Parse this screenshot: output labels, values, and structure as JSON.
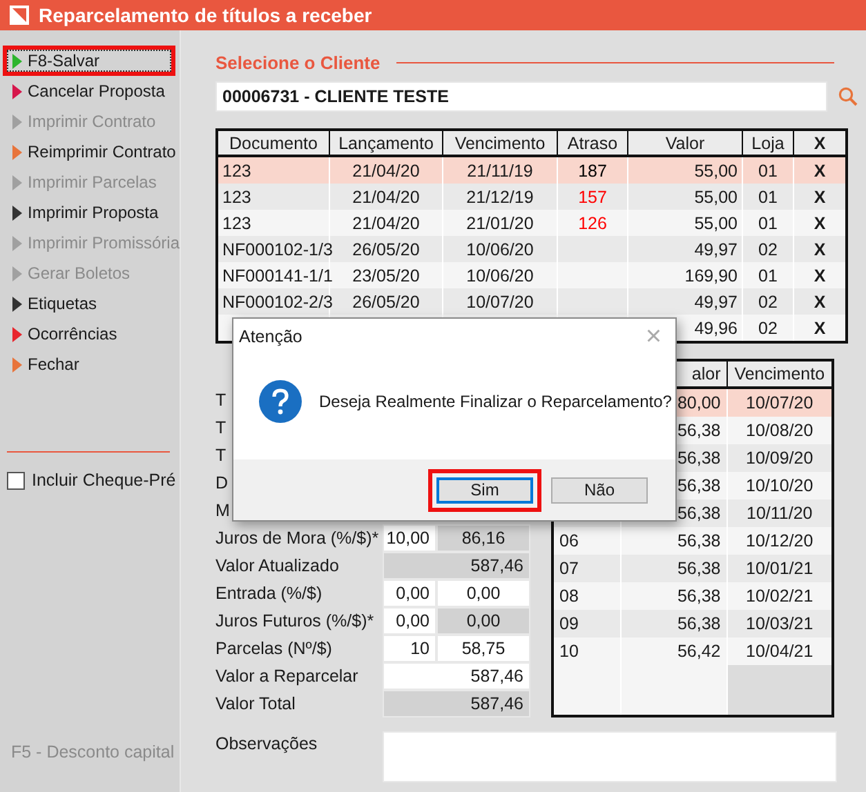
{
  "window": {
    "title": "Reparcelamento de títulos a receber"
  },
  "sidebar": {
    "items": [
      {
        "label": "F8-Salvar",
        "color": "#2db52d",
        "disabled": false,
        "focused": true,
        "highlighted": true
      },
      {
        "label": "Cancelar Proposta",
        "color": "#d6164b",
        "disabled": false,
        "focused": false,
        "highlighted": false
      },
      {
        "label": "Imprimir Contrato",
        "color": "#a0a0a0",
        "disabled": true,
        "focused": false,
        "highlighted": false
      },
      {
        "label": "Reimprimir Contrato",
        "color": "#e8743b",
        "disabled": false,
        "focused": false,
        "highlighted": false
      },
      {
        "label": "Imprimir Parcelas",
        "color": "#a0a0a0",
        "disabled": true,
        "focused": false,
        "highlighted": false
      },
      {
        "label": "Imprimir Proposta",
        "color": "#333333",
        "disabled": false,
        "focused": false,
        "highlighted": false
      },
      {
        "label": "Imprimir Promissória",
        "color": "#a0a0a0",
        "disabled": true,
        "focused": false,
        "highlighted": false
      },
      {
        "label": "Gerar Boletos",
        "color": "#a0a0a0",
        "disabled": true,
        "focused": false,
        "highlighted": false
      },
      {
        "label": "Etiquetas",
        "color": "#333333",
        "disabled": false,
        "focused": false,
        "highlighted": false
      },
      {
        "label": "Ocorrências",
        "color": "#e8242c",
        "disabled": false,
        "focused": false,
        "highlighted": false
      },
      {
        "label": "Fechar",
        "color": "#e8743b",
        "disabled": false,
        "focused": false,
        "highlighted": false
      }
    ],
    "checkbox": {
      "label": "Incluir Cheque-Pré",
      "checked": false
    },
    "footer": "F5 - Desconto capital"
  },
  "client": {
    "heading": "Selecione o Cliente",
    "value": "00006731 - CLIENTE TESTE"
  },
  "titles_table": {
    "columns": [
      "Documento",
      "Lançamento",
      "Vencimento",
      "Atraso",
      "Valor",
      "Loja",
      "X"
    ],
    "rows": [
      {
        "documento": "123",
        "lancamento": "21/04/20",
        "vencimento": "21/11/19",
        "atraso": "187",
        "color": "#000000",
        "valor": "55,00",
        "loja": "01",
        "remove": "X",
        "selected": true
      },
      {
        "documento": "123",
        "lancamento": "21/04/20",
        "vencimento": "21/12/19",
        "atraso": "157",
        "color": "#ff0000",
        "valor": "55,00",
        "loja": "01",
        "remove": "X",
        "selected": false
      },
      {
        "documento": "123",
        "lancamento": "21/04/20",
        "vencimento": "21/01/20",
        "atraso": "126",
        "color": "#ff0000",
        "valor": "55,00",
        "loja": "01",
        "remove": "X",
        "selected": false
      },
      {
        "documento": "NF000102-1/3",
        "lancamento": "26/05/20",
        "vencimento": "10/06/20",
        "valor": "49,97",
        "loja": "02",
        "remove": "X",
        "selected": false
      },
      {
        "documento": "NF000141-1/1",
        "lancamento": "23/05/20",
        "vencimento": "10/06/20",
        "valor": "169,90",
        "loja": "01",
        "remove": "X",
        "selected": false
      },
      {
        "documento": "NF000102-2/3",
        "lancamento": "26/05/20",
        "vencimento": "10/07/20",
        "valor": "49,97",
        "loja": "02",
        "remove": "X",
        "selected": false
      },
      {
        "valor": "49,96",
        "loja": "02",
        "remove": "X",
        "selected": false
      }
    ]
  },
  "form": {
    "rows": [
      {
        "label": "T"
      },
      {
        "label": "T"
      },
      {
        "label": "T"
      },
      {
        "label": "D"
      },
      {
        "label": "M"
      },
      {
        "label": "Juros de Mora (%/$)*",
        "cells": [
          {
            "text": "10,00",
            "editable": true
          },
          {
            "text": "86,16",
            "editable": false
          }
        ]
      },
      {
        "label": "Valor Atualizado",
        "cells": [
          {
            "text": "587,46",
            "editable": false
          }
        ]
      },
      {
        "label": "Entrada (%/$)",
        "cells": [
          {
            "text": "0,00",
            "editable": true
          },
          {
            "text": "0,00",
            "editable": true
          }
        ]
      },
      {
        "label": "Juros Futuros (%/$)*",
        "cells": [
          {
            "text": "0,00",
            "editable": true
          },
          {
            "text": "0,00",
            "editable": false
          }
        ]
      },
      {
        "label": "Parcelas (Nº/$)",
        "cells": [
          {
            "text": "10",
            "editable": true
          },
          {
            "text": "58,75",
            "editable": true
          }
        ]
      },
      {
        "label": "Valor a Reparcelar",
        "cells": [
          {
            "text": "587,46",
            "editable": true
          }
        ]
      },
      {
        "label": "Valor Total",
        "cells": [
          {
            "text": "587,46",
            "editable": false
          }
        ]
      }
    ],
    "notes_label": "Observações"
  },
  "installments_table": {
    "columns": [
      "alor",
      "Vencimento"
    ],
    "rows": [
      {
        "valor": "80,00",
        "vencimento": "10/07/20",
        "selected": true
      },
      {
        "valor": "56,38",
        "vencimento": "10/08/20",
        "selected": false
      },
      {
        "valor": "56,38",
        "vencimento": "10/09/20",
        "selected": false
      },
      {
        "valor": "56,38",
        "vencimento": "10/10/20",
        "selected": false
      },
      {
        "valor": "56,38",
        "vencimento": "10/11/20",
        "selected": false
      },
      {
        "parcela": "06",
        "valor": "56,38",
        "vencimento": "10/12/20",
        "selected": false
      },
      {
        "parcela": "07",
        "valor": "56,38",
        "vencimento": "10/01/21",
        "selected": false
      },
      {
        "parcela": "08",
        "valor": "56,38",
        "vencimento": "10/02/21",
        "selected": false
      },
      {
        "parcela": "09",
        "valor": "56,38",
        "vencimento": "10/03/21",
        "selected": false
      },
      {
        "parcela": "10",
        "valor": "56,42",
        "vencimento": "10/04/21",
        "selected": false
      }
    ]
  },
  "dialog": {
    "title": "Atenção",
    "close": "×",
    "message": "Deseja Realmente Finalizar o Reparcelamento?",
    "buttons": [
      {
        "label": "Sim",
        "focused": true,
        "highlighted": true
      },
      {
        "label": "Não",
        "focused": false,
        "highlighted": false
      }
    ]
  }
}
